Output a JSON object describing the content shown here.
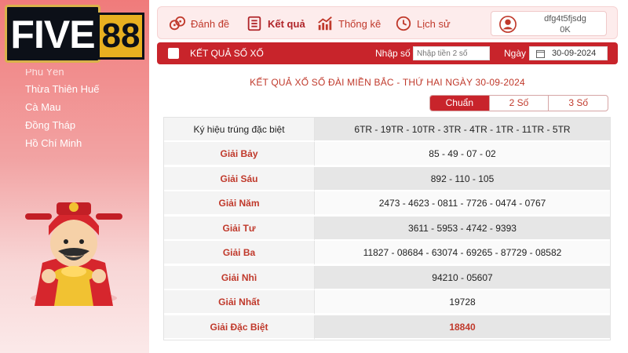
{
  "logo": {
    "part1": "FIVE",
    "part2": "88"
  },
  "sidebar": {
    "items": [
      {
        "label": "Phú Yên"
      },
      {
        "label": "Thừa Thiên Huế"
      },
      {
        "label": "Cà Mau"
      },
      {
        "label": "Đồng Tháp"
      },
      {
        "label": "Hồ Chí Minh"
      }
    ]
  },
  "nav": {
    "items": [
      {
        "label": "Đánh đề",
        "icon": "dice-icon"
      },
      {
        "label": "Kết quả",
        "icon": "list-icon"
      },
      {
        "label": "Thống kê",
        "icon": "chart-icon"
      },
      {
        "label": "Lịch sử",
        "icon": "clock-icon"
      }
    ],
    "user": {
      "name": "dfg4t5fjsdg",
      "balance": "0K"
    }
  },
  "search": {
    "title": "KẾT QUẢ SỐ XỐ",
    "number_label": "Nhập số",
    "number_placeholder": "Nhập tiền 2 số",
    "date_label": "Ngày",
    "date_value": "30-09-2024"
  },
  "result": {
    "heading": "KẾT QUẢ XỔ SỐ ĐÀI MIỀN BẮC - THỨ HAI NGÀY 30-09-2024",
    "tabs": [
      {
        "label": "Chuẩn",
        "active": true
      },
      {
        "label": "2 Số",
        "active": false
      },
      {
        "label": "3 Số",
        "active": false
      }
    ],
    "rows": [
      {
        "prize": "Ký hiệu trúng đặc biệt",
        "numbers": "6TR - 19TR - 10TR - 3TR - 4TR - 1TR - 11TR - 5TR"
      },
      {
        "prize": "Giải Bảy",
        "numbers": "85 - 49 - 07 - 02"
      },
      {
        "prize": "Giải Sáu",
        "numbers": "892 - 110 - 105"
      },
      {
        "prize": "Giải Năm",
        "numbers": "2473 - 4623 - 0811 - 7726 - 0474 - 0767"
      },
      {
        "prize": "Giải Tư",
        "numbers": "3611 - 5953 - 4742 - 9393"
      },
      {
        "prize": "Giải Ba",
        "numbers": "11827 - 08684 - 63074 - 69265 - 87729 - 08582"
      },
      {
        "prize": "Giải Nhì",
        "numbers": "94210 - 05607"
      },
      {
        "prize": "Giải Nhất",
        "numbers": "19728"
      },
      {
        "prize": "Giải Đặc Biệt",
        "numbers": "18840"
      }
    ]
  },
  "colors": {
    "brand_red": "#c8242b",
    "accent_text": "#c0392b",
    "sidebar_top": "#f07b7b"
  }
}
